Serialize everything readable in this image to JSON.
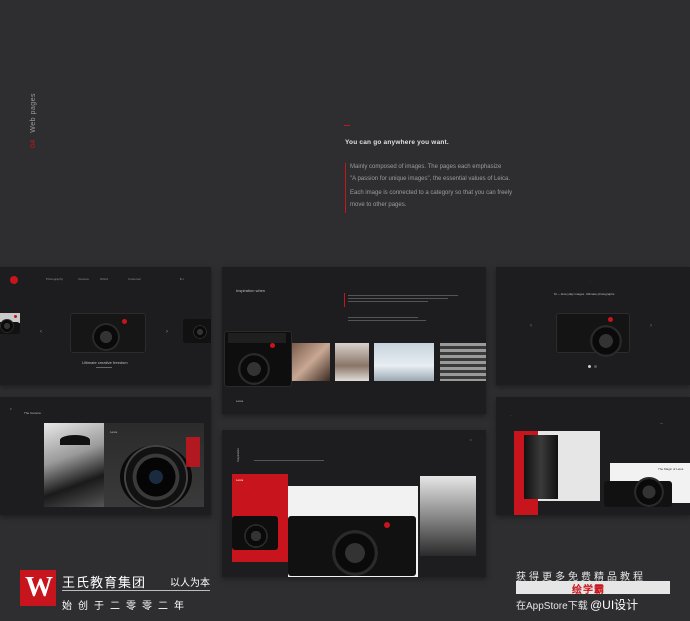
{
  "side": {
    "num": "04",
    "label": "Web pages"
  },
  "intro": {
    "title": "You can go anywhere you want.",
    "p1a": "Mainly composed of images. The pages each emphasize",
    "p1b": "\"A passion for unique images\", the essential values of Leica.",
    "p2a": "Each image is connected to a category so that you can freely",
    "p2b": "move to other pages."
  },
  "card1": {
    "caption": "Ultimate creative freedom",
    "nav": [
      "Photography",
      "Camera",
      "World",
      "Customer"
    ]
  },
  "card2": {
    "heading": "Inspiration when"
  },
  "card3": {
    "heading": "M — Everyday images. Ultimate photographs"
  },
  "card4": {
    "heading": "The Camera"
  },
  "card5": {
    "heading": "Inspiration"
  },
  "card6": {
    "heading": "The Magic of Leica"
  },
  "brand": {
    "logo": "W",
    "name": "王氏教育集团",
    "tagline": "以人为本",
    "sub": "始创于二零零二年"
  },
  "promo": {
    "line1": "获得更多免费精品教程",
    "box": "绘学霸",
    "line2": "在AppStore下载",
    "weibo": "@UI设计"
  }
}
